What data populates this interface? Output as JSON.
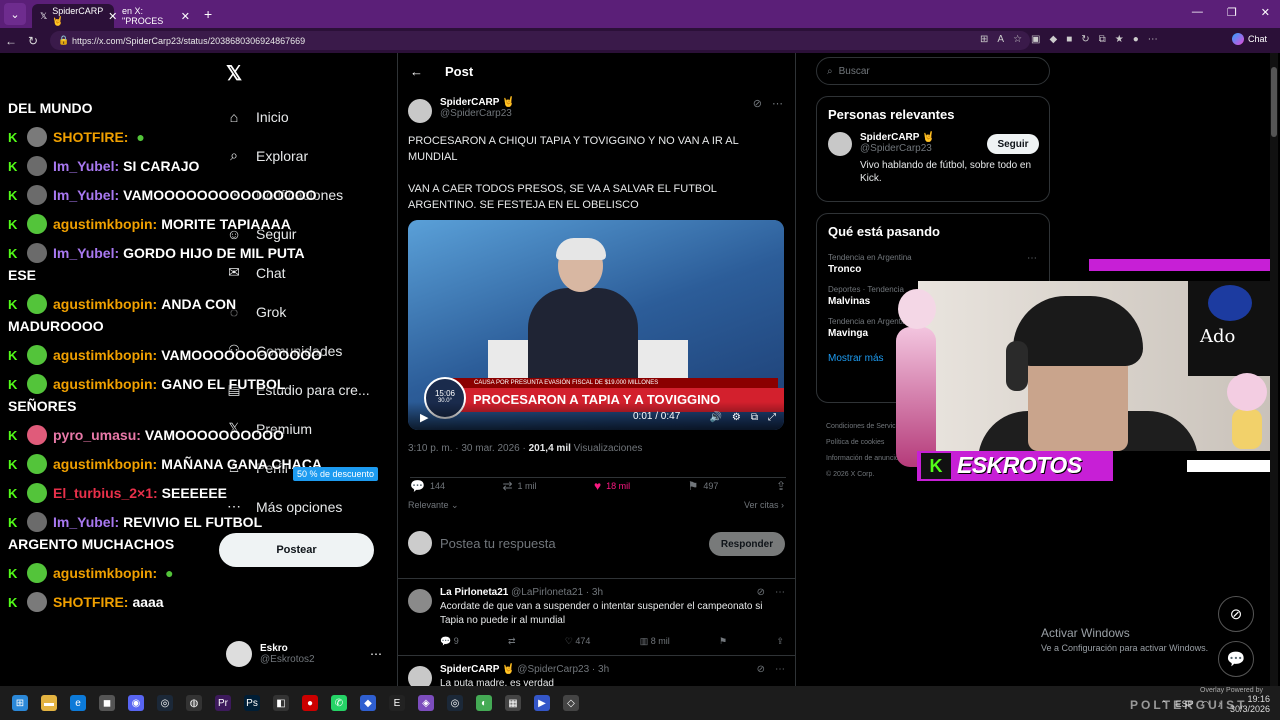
{
  "browser": {
    "tabs": [
      {
        "label": "SpiderCARP 🤘",
        "active": true
      },
      {
        "label": "en X: \"PROCES",
        "active": false
      }
    ],
    "url": "https://x.com/SpiderCarp23/status/2038680306924867669",
    "chat_label": "Chat"
  },
  "sidebar": {
    "items": [
      {
        "label": "Inicio",
        "icon": "home-icon"
      },
      {
        "label": "Explorar",
        "icon": "search-icon"
      },
      {
        "label": "Notificaciones",
        "icon": "bell-icon"
      },
      {
        "label": "Seguir",
        "icon": "person-icon"
      },
      {
        "label": "Chat",
        "icon": "mail-icon"
      },
      {
        "label": "Grok",
        "icon": "grok-icon"
      },
      {
        "label": "Comunidades",
        "icon": "people-icon"
      },
      {
        "label": "Estudio para cre...",
        "icon": "studio-icon"
      },
      {
        "label": "Premium",
        "icon": "x-icon"
      },
      {
        "label": "Perfil",
        "icon": "profile-icon"
      },
      {
        "label": "Más opciones",
        "icon": "more-icon"
      }
    ],
    "post_button": "Postear",
    "account": {
      "name": "Eskro",
      "handle": "@Eskrotos2"
    }
  },
  "stream_chat": {
    "lines": [
      {
        "user": "",
        "text": "DEL MUNDO",
        "color": "#ffffff",
        "cont": true
      },
      {
        "user": "SHOTFIRE:",
        "text": "",
        "color": "#f0a000",
        "badge": "#7a7a7a"
      },
      {
        "user": "Im_Yubel:",
        "text": "SI CARAJO",
        "color": "#a878f0",
        "badge": "#6b6b6b"
      },
      {
        "user": "Im_Yubel:",
        "text": "VAMOOOOOOOOOOOOOOO",
        "color": "#a878f0",
        "badge": "#6b6b6b"
      },
      {
        "user": "agustimkbopin:",
        "text": "MORITE TAPIAAAA",
        "color": "#f0a000",
        "badge": "#53c43a"
      },
      {
        "user": "Im_Yubel:",
        "text": "GORDO HIJO DE MIL PUTA ESE",
        "color": "#a878f0",
        "badge": "#6b6b6b"
      },
      {
        "user": "agustimkbopin:",
        "text": "ANDA CON MADUROOOO",
        "color": "#f0a000",
        "badge": "#53c43a"
      },
      {
        "user": "agustimkbopin:",
        "text": "VAMOOOOOOOOOOOO",
        "color": "#f0a000",
        "badge": "#53c43a"
      },
      {
        "user": "agustimkbopin:",
        "text": "GANO EL FUTBOL SEÑORES",
        "color": "#f0a000",
        "badge": "#53c43a"
      },
      {
        "user": "pyro_umasu:",
        "text": "VAMOOOOOOOOOO",
        "color": "#e879a8",
        "badge": "#e05b7a"
      },
      {
        "user": "agustimkbopin:",
        "text": "MAÑANA GANA CHACA",
        "color": "#f0a000",
        "badge": "#53c43a"
      },
      {
        "user": "El_turbius_2×1:",
        "text": "SEEEEEE",
        "color": "#e8304a",
        "badge": "#53c43a"
      },
      {
        "user": "Im_Yubel:",
        "text": "REVIVIO EL FUTBOL ARGENTO MUCHACHOS",
        "color": "#a878f0",
        "badge": "#6b6b6b"
      },
      {
        "user": "agustimkbopin:",
        "text": "",
        "color": "#f0a000",
        "badge": "#53c43a"
      },
      {
        "user": "SHOTFIRE:",
        "text": "aaaa",
        "color": "#f0a000",
        "badge": "#7a7a7a"
      }
    ],
    "discount_tag": "50 % de descuento"
  },
  "post": {
    "header_title": "Post",
    "author_name": "SpiderCARP 🤘",
    "author_handle": "@SpiderCarp23",
    "text_1": "PROCESARON A CHIQUI TAPIA Y TOVIGGINO Y NO VAN A IR AL MUNDIAL",
    "text_2": "VAN A CAER TODOS PRESOS, SE VA A SALVAR EL FUTBOL ARGENTINO. SE FESTEJA EN EL OBELISCO",
    "media": {
      "ticker_top": "CAUSA POR PRESUNTA EVASIÓN FISCAL DE $19.000 MILLONES",
      "headline": "PROCESARON A TAPIA Y A TOVIGGINO",
      "clock_time": "15:06",
      "clock_temp": "30.0°",
      "video_time": "0:01 / 0:47"
    },
    "time": "3:10 p. m. · 30 mar. 2026 · ",
    "views": "201,4 mil",
    "views_label": " Visualizaciones",
    "stats": {
      "replies": "144",
      "reposts": "1 mil",
      "likes": "18 mil",
      "bookmarks": "497"
    },
    "sort_label": "Relevante",
    "quotes_label": "Ver citas",
    "reply_placeholder": "Postea tu respuesta",
    "reply_button": "Responder"
  },
  "replies": [
    {
      "name": "La Pirloneta21",
      "handle": "@LaPirloneta21 · 3h",
      "text": "Acordate de que van a suspender o intentar suspender el campeonato si Tapia no puede ir al mundial",
      "replies": "9",
      "reposts": "",
      "likes": "474",
      "views": "8 mil"
    },
    {
      "name": "SpiderCARP 🤘",
      "handle": "@SpiderCarp23 · 3h",
      "text": "La puta madre, es verdad",
      "replies": "",
      "reposts": "",
      "likes": "",
      "views": ""
    }
  ],
  "right": {
    "search_placeholder": "Buscar",
    "relevant_title": "Personas relevantes",
    "relevant": {
      "name": "SpiderCARP 🤘",
      "handle": "@SpiderCarp23",
      "bio": "Vivo hablando de fútbol, sobre todo en Kick.",
      "follow": "Seguir"
    },
    "trends_title": "Qué está pasando",
    "trends": [
      {
        "ctx": "Tendencia en Argentina",
        "name": "Tronco"
      },
      {
        "ctx": "Deportes · Tendencia",
        "name": "Malvinas"
      },
      {
        "ctx": "Tendencia en Argentina",
        "name": "Mavinga"
      }
    ],
    "show_more": "Mostrar más",
    "footer": [
      "Condiciones de Servicio",
      "Política de cookies",
      "Información de anuncios",
      "© 2026 X Corp."
    ]
  },
  "overlay": {
    "streamer_name": "ESKROTOS",
    "poster_text": "Ado"
  },
  "windows": {
    "activate_title": "Activar Windows",
    "activate_sub": "Ve a Configuración para activar Windows.",
    "clock_time": "19:16",
    "clock_date": "30/3/2026",
    "lang": "ESP",
    "watermark": "POLTERGUIST",
    "overlay_label": "Overlay Powered by"
  },
  "colors": {
    "accent": "#1d9bf0",
    "like": "#f91880",
    "kick": "#53fc18",
    "overlay": "#c71fd6"
  }
}
